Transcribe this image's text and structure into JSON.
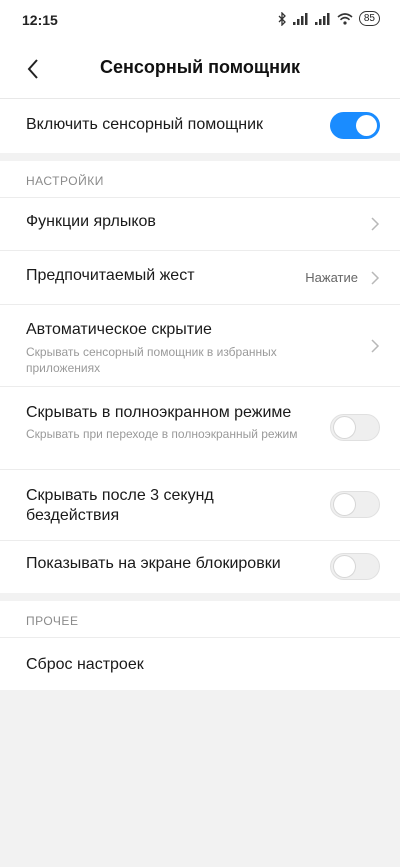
{
  "status_bar": {
    "time": "12:15",
    "battery": "85",
    "icons": [
      "bluetooth-icon",
      "signal-icon",
      "signal-icon",
      "wifi-icon",
      "battery-icon"
    ]
  },
  "header": {
    "title": "Сенсорный помощник",
    "back_icon": "chevron-left-icon"
  },
  "master": {
    "label": "Включить сенсорный помощник",
    "enabled": true,
    "accent_color": "#1a8cff"
  },
  "settings": {
    "section_title": "НАСТРОЙКИ",
    "shortcuts_label": "Функции ярлыков",
    "gesture_label": "Предпочитаемый жест",
    "gesture_value": "Нажатие",
    "autohide_label": "Автоматическое скрытие",
    "autohide_sub": "Скрывать сенсорный помощник в избранных приложениях",
    "fullscreen_label": "Скрывать в полноэкранном режиме",
    "fullscreen_sub": "Скрывать при переходе в полноэкранный режим",
    "fullscreen_enabled": false,
    "idle_label": "Скрывать после 3 секунд бездействия",
    "idle_enabled": false,
    "lockscreen_label": "Показывать на экране блокировки",
    "lockscreen_enabled": false
  },
  "other": {
    "section_title": "ПРОЧЕЕ",
    "reset_label": "Сброс настроек"
  }
}
